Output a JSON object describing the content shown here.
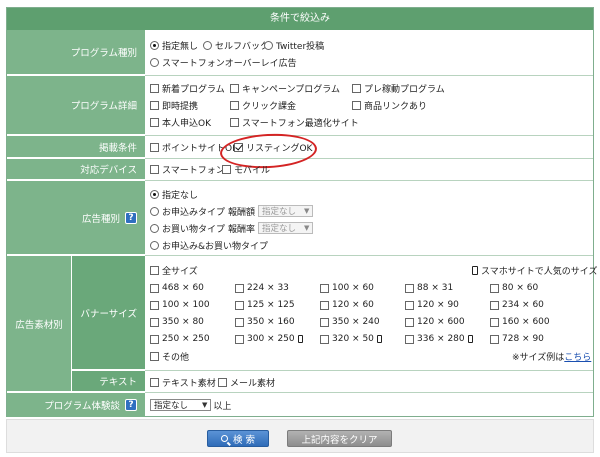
{
  "header": {
    "title": "条件で絞込み"
  },
  "program_type": {
    "label": "プログラム種別",
    "options": [
      "指定無し",
      "セルフバック",
      "Twitter投稿",
      "スマートフォンオーバーレイ広告"
    ],
    "selected": "指定無し"
  },
  "program_detail": {
    "label": "プログラム詳細",
    "items": [
      "新着プログラム",
      "キャンペーンプログラム",
      "プレ稼動プログラム",
      "即時提携",
      "クリック課金",
      "商品リンクあり",
      "本人申込OK",
      "スマートフォン最適化サイト"
    ]
  },
  "listing": {
    "label": "掲載条件",
    "items": [
      {
        "label": "ポイントサイトOK",
        "checked": false
      },
      {
        "label": "リスティングOK",
        "checked": true
      }
    ]
  },
  "device": {
    "label": "対応デバイス",
    "items": [
      "スマートフォン",
      "モバイル"
    ]
  },
  "ad_type": {
    "label": "広告種別",
    "options": [
      "指定なし",
      "お申込みタイプ",
      "お買い物タイプ",
      "お申込み&お買い物タイプ"
    ],
    "selected": "指定なし",
    "reward_amount_label": "報酬額",
    "reward_rate_label": "報酬率",
    "select_value": "指定なし"
  },
  "material": {
    "label": "広告素材別",
    "banner_label": "バナーサイズ",
    "all_sizes": "全サイズ",
    "smartphone_popular": "スマホサイトで人気のサイズ",
    "sizes": [
      "468 × 60",
      "224 × 33",
      "100 × 60",
      "88 × 31",
      "80 × 60",
      "100 × 100",
      "125 × 125",
      "120 × 60",
      "120 × 90",
      "234 × 60",
      "350 × 80",
      "350 × 160",
      "350 × 240",
      "120 × 600",
      "160 × 600",
      "250 × 250",
      "300 × 250",
      "320 × 50",
      "336 × 280",
      "728 × 90"
    ],
    "other": "その他",
    "size_example_prefix": "※サイズ例は",
    "size_example_link": "こちら",
    "text_label": "テキスト",
    "text_items": [
      "テキスト素材",
      "メール素材"
    ]
  },
  "experience": {
    "label": "プログラム体験談",
    "select_value": "指定なし",
    "suffix": "以上"
  },
  "buttons": {
    "search": "検 索",
    "clear": "上記内容をクリア"
  },
  "colors": {
    "header": "#5e9f6f",
    "label_bg": "#7db48b",
    "highlight_ring": "#d42424",
    "search_button": "#2f6cb8"
  }
}
